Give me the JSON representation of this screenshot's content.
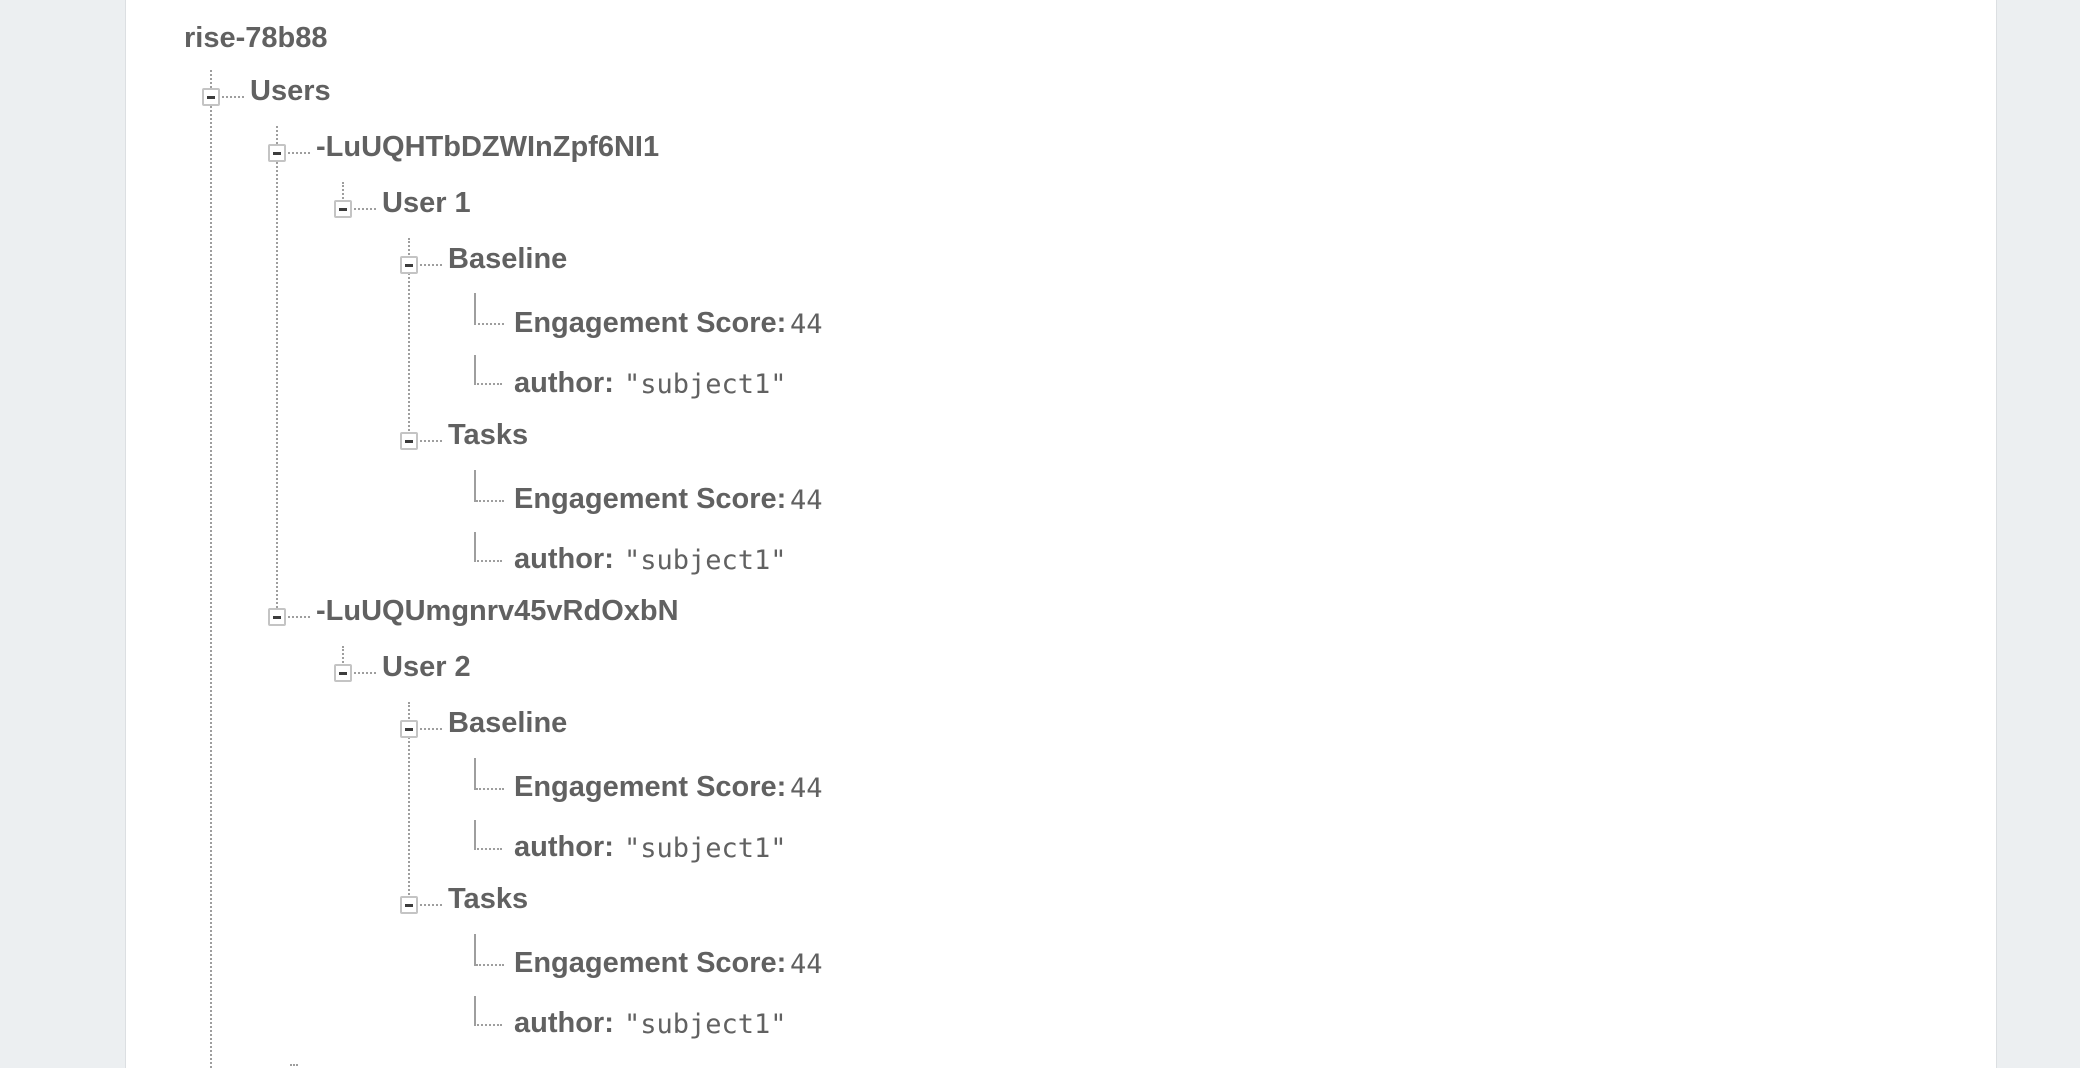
{
  "root": "rise-78b88",
  "users_node": "Users",
  "entries": [
    {
      "id": "-LuUQHTbDZWInZpf6NI1",
      "user": "User 1",
      "groups": [
        {
          "name": "Baseline",
          "fields": [
            {
              "key": "Engagement Score:",
              "value": "44"
            },
            {
              "key": "author:",
              "value": "\"subject1\""
            }
          ]
        },
        {
          "name": "Tasks",
          "fields": [
            {
              "key": "Engagement Score:",
              "value": "44"
            },
            {
              "key": "author:",
              "value": "\"subject1\""
            }
          ]
        }
      ]
    },
    {
      "id": "-LuUQUmgnrv45vRdOxbN",
      "user": "User 2",
      "groups": [
        {
          "name": "Baseline",
          "fields": [
            {
              "key": "Engagement Score:",
              "value": "44"
            },
            {
              "key": "author:",
              "value": "\"subject1\""
            }
          ]
        },
        {
          "name": "Tasks",
          "fields": [
            {
              "key": "Engagement Score:",
              "value": "44"
            },
            {
              "key": "author:",
              "value": "\"subject1\""
            }
          ]
        }
      ]
    }
  ]
}
